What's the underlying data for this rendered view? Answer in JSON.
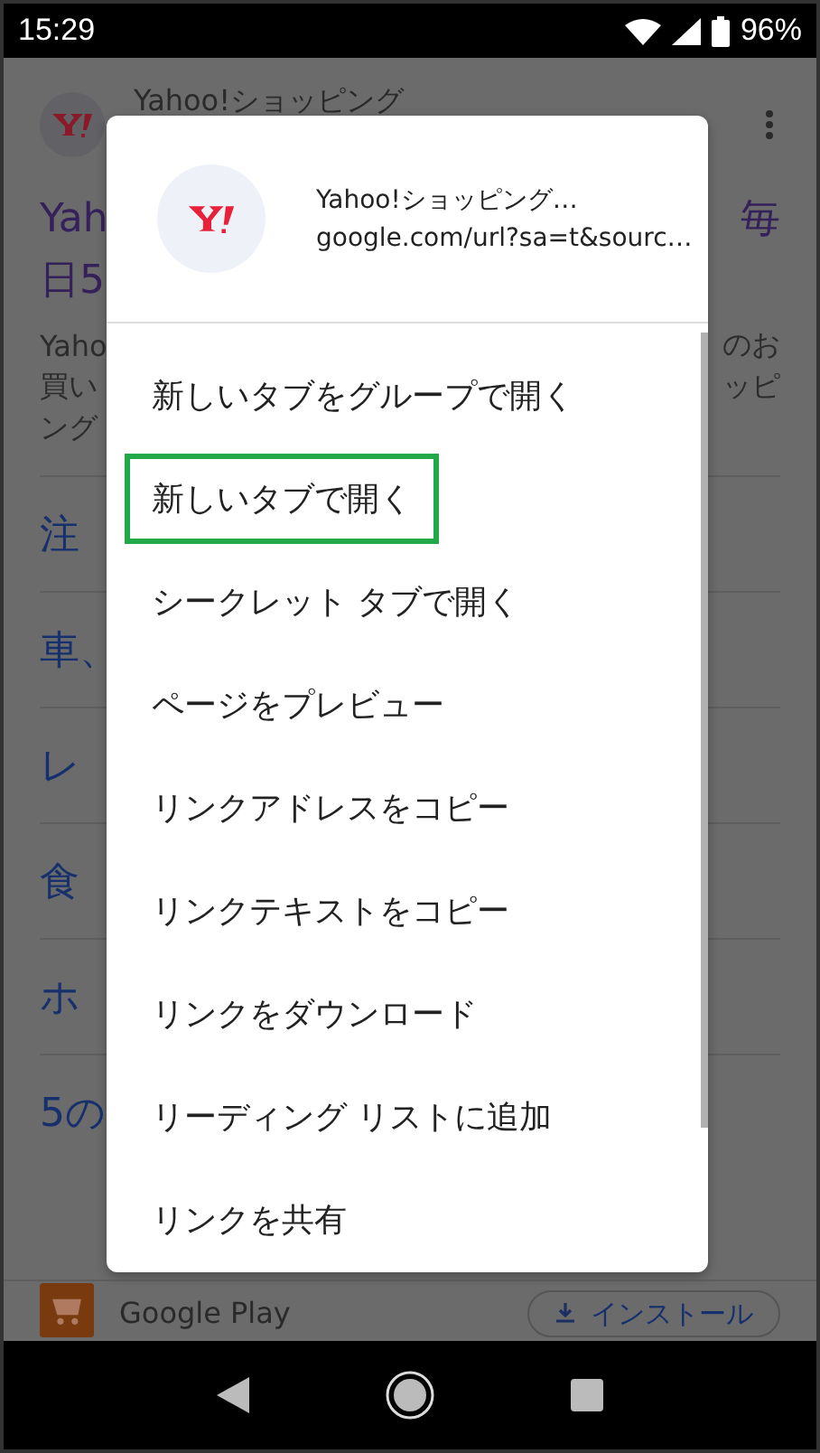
{
  "status_bar": {
    "time": "15:29",
    "battery": "96%"
  },
  "page": {
    "site_name": "Yahoo!ショッピング",
    "title_left": [
      "Yah",
      "日5"
    ],
    "title_right": [
      "毎"
    ],
    "snippet_left": [
      "Yaho",
      "買い",
      "ング"
    ],
    "snippet_right": [
      "のお",
      "ッピ"
    ],
    "links": [
      "注",
      "車、",
      "レ",
      "食",
      "ホ",
      "5の"
    ],
    "app_banner": {
      "store": "Google Play",
      "install": "インストール"
    }
  },
  "dialog": {
    "title": "Yahoo!ショッピング…",
    "url": "google.com/url?sa=t&sourc…",
    "items": [
      {
        "label": "新しいタブをグループで開く",
        "highlighted": false
      },
      {
        "label": "新しいタブで開く",
        "highlighted": true
      },
      {
        "label": "シークレット タブで開く",
        "highlighted": false
      },
      {
        "label": "ページをプレビュー",
        "highlighted": false
      },
      {
        "label": "リンクアドレスをコピー",
        "highlighted": false
      },
      {
        "label": "リンクテキストをコピー",
        "highlighted": false
      },
      {
        "label": "リンクをダウンロード",
        "highlighted": false
      },
      {
        "label": "リーディング リストに追加",
        "highlighted": false
      },
      {
        "label": "リンクを共有",
        "highlighted": false
      }
    ]
  }
}
